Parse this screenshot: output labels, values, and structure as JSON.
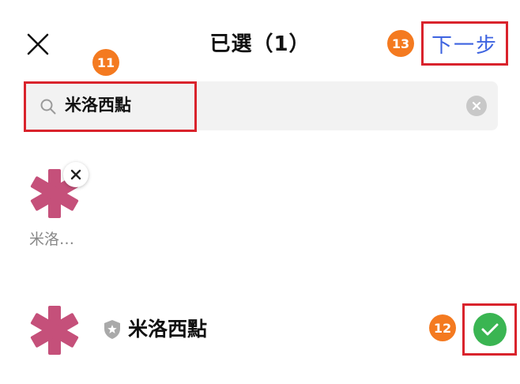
{
  "header": {
    "title": "已選（1）",
    "next_label": "下一步",
    "close_icon": "close-icon"
  },
  "search": {
    "value": "米洛西點",
    "icon": "search-icon",
    "clear_icon": "clear-icon"
  },
  "selected": {
    "label": "米洛…",
    "remove_icon": "close-icon"
  },
  "results": [
    {
      "name": "米洛西點",
      "badge_icon": "shield-star-icon",
      "checked": true
    }
  ],
  "annotations": {
    "search": "11",
    "check": "12",
    "next": "13"
  },
  "colors": {
    "accent_blue": "#3d63e0",
    "highlight_red": "#d9232c",
    "badge_orange": "#f47a20",
    "check_green": "#3ab552",
    "avatar_pink": "#c5507a"
  }
}
